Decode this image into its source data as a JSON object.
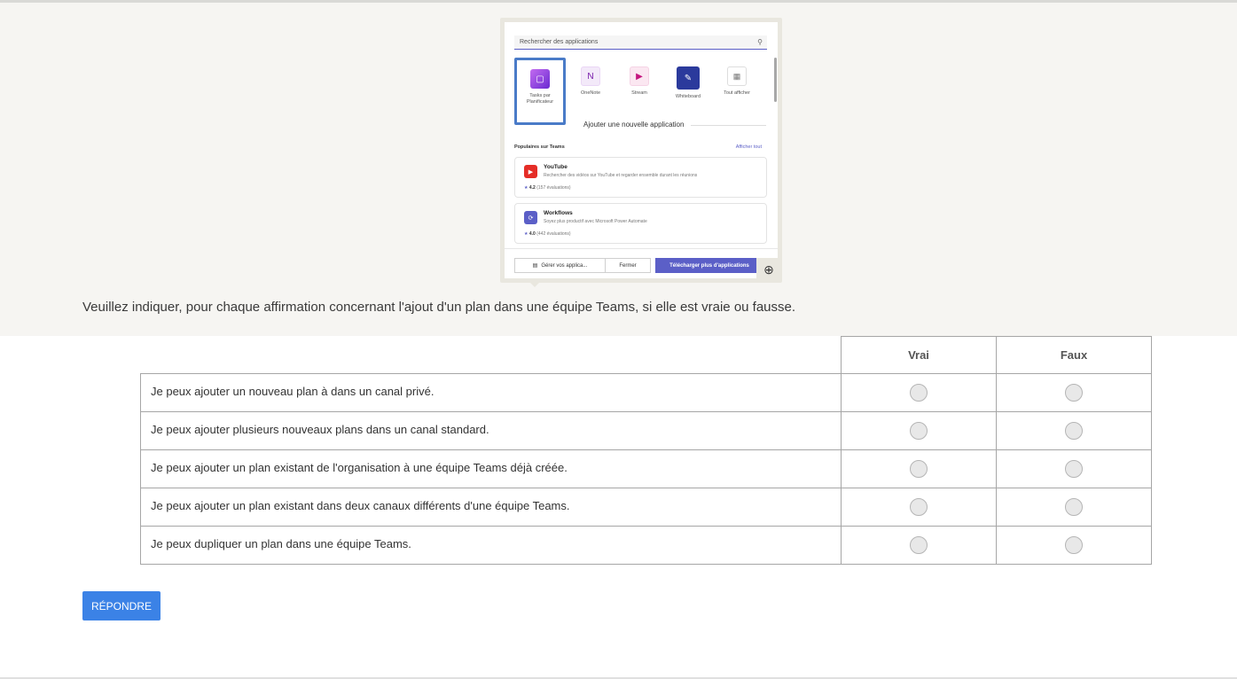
{
  "screenshot": {
    "search_placeholder": "Rechercher des applications",
    "apps": [
      {
        "label": "Tasks par Planificateur",
        "icon": "planner-icon",
        "color": "#7b3fc9"
      },
      {
        "label": "OneNote",
        "icon": "onenote-icon",
        "color": "#7719aa"
      },
      {
        "label": "Stream",
        "icon": "stream-icon",
        "color": "#c4167f"
      },
      {
        "label": "Whiteboard",
        "icon": "whiteboard-icon",
        "color": "#2b3a9c"
      },
      {
        "label": "Tout afficher",
        "icon": "grid-icon",
        "color": "#888888"
      }
    ],
    "add_new_label": "Ajouter une nouvelle application",
    "popular_heading": "Populaires sur Teams",
    "popular_show_all": "Afficher tout",
    "popular_apps": [
      {
        "name": "YouTube",
        "description": "Rechercher des vidéos sur YouTube et regarder ensemble durant les réunions",
        "rating": "4.2",
        "reviews": "(157 évaluations)",
        "color": "#e52d27"
      },
      {
        "name": "Workflows",
        "description": "Soyez plus productif avec Microsoft Power Automate",
        "rating": "4.0",
        "reviews": "(442 évaluations)",
        "color": "#5b5fc7"
      }
    ],
    "footer": {
      "manage_label": "Gérer vos applica...",
      "close_label": "Fermer",
      "download_label": "Télécharger plus d'applications"
    }
  },
  "question": {
    "text": "Veuillez indiquer, pour chaque affirmation concernant l'ajout d'un plan dans une équipe Teams, si elle est vraie ou fausse."
  },
  "matrix": {
    "columns": [
      "Vrai",
      "Faux"
    ],
    "rows": [
      "Je peux ajouter un nouveau plan à dans un canal privé.",
      "Je peux ajouter plusieurs nouveaux plans dans un canal standard.",
      "Je peux ajouter un plan existant de l'organisation à une équipe Teams déjà créée.",
      "Je peux ajouter un plan existant dans deux canaux différents d'une équipe Teams.",
      "Je peux dupliquer un plan dans une équipe Teams."
    ]
  },
  "submit_label": "RÉPONDRE"
}
